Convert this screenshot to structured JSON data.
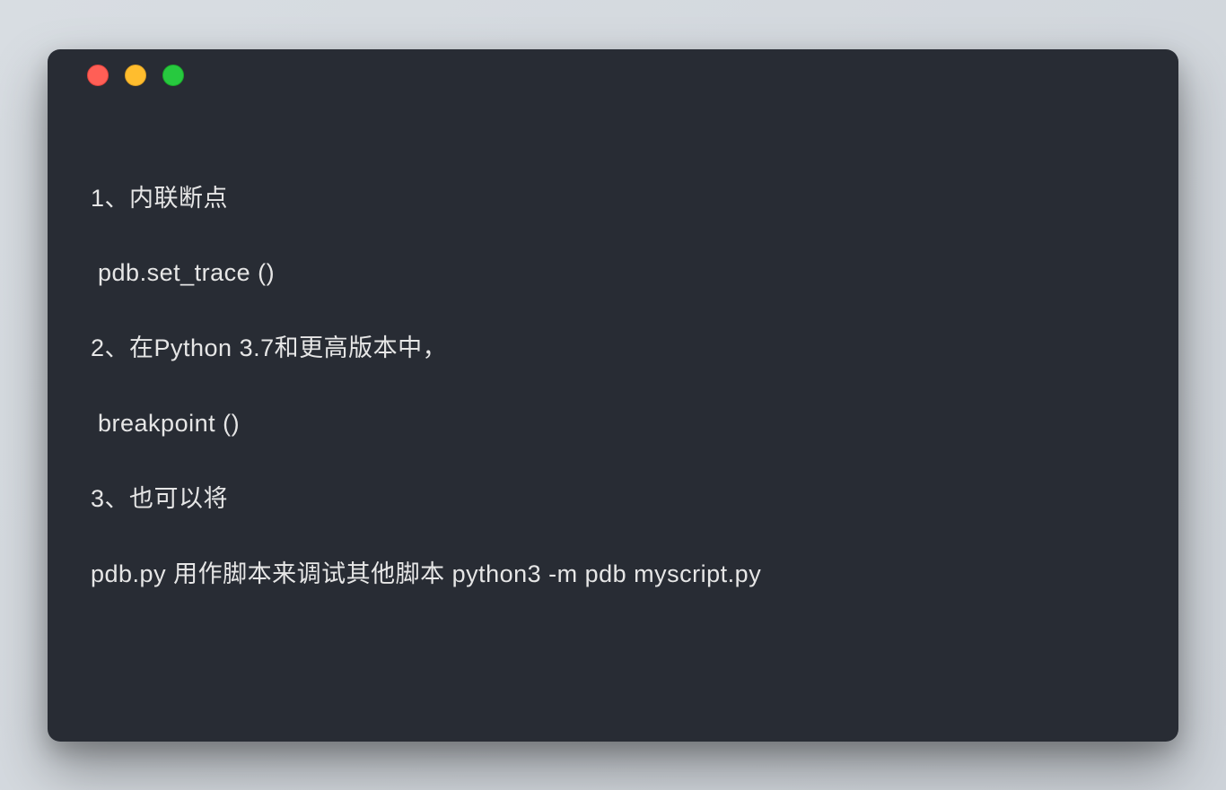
{
  "window": {
    "traffic_lights": {
      "red": "#ff5f56",
      "yellow": "#ffbd2e",
      "green": "#27c93f"
    }
  },
  "content": {
    "lines": [
      "1、内联断点",
      " pdb.set_trace ()",
      "2、在Python 3.7和更高版本中，",
      " breakpoint ()",
      "3、也可以将",
      "pdb.py 用作脚本来调试其他脚本 python3 -m pdb myscript.py"
    ]
  }
}
